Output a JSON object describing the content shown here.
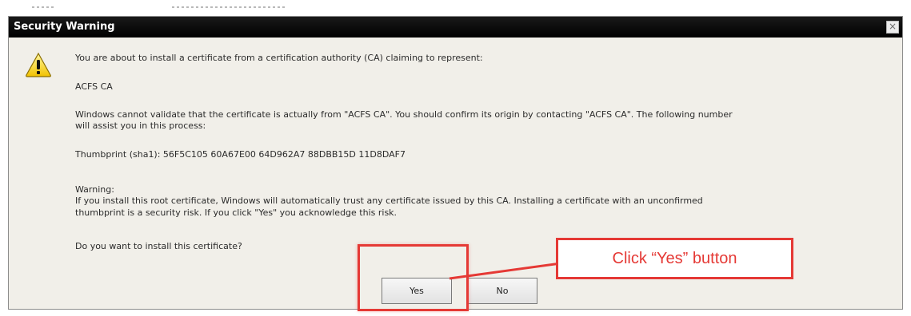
{
  "dialog": {
    "title": "Security Warning",
    "close_glyph": "×",
    "icon": "warning-icon",
    "intro": "You are about to install a certificate from a certification authority (CA) claiming to represent:",
    "ca_name": "ACFS CA",
    "validation_line1": "Windows cannot validate that the certificate is actually from \"ACFS CA\". You should confirm its origin by contacting \"ACFS CA\". The following number",
    "validation_line2": "will assist you in this process:",
    "thumbprint": "Thumbprint (sha1): 56F5C105 60A67E00 64D962A7 88DBB15D 11D8DAF7",
    "warning_heading": "Warning:",
    "warning_line1": "If you install this root certificate, Windows will automatically trust any certificate issued by this CA. Installing a certificate with an unconfirmed",
    "warning_line2": "thumbprint is a security risk. If you click \"Yes\" you acknowledge this risk.",
    "question": "Do you want to install this certificate?",
    "yes_label": "Yes",
    "no_label": "No"
  },
  "annotation": {
    "callout_text": "Click “Yes” button",
    "color": "#e53935"
  }
}
